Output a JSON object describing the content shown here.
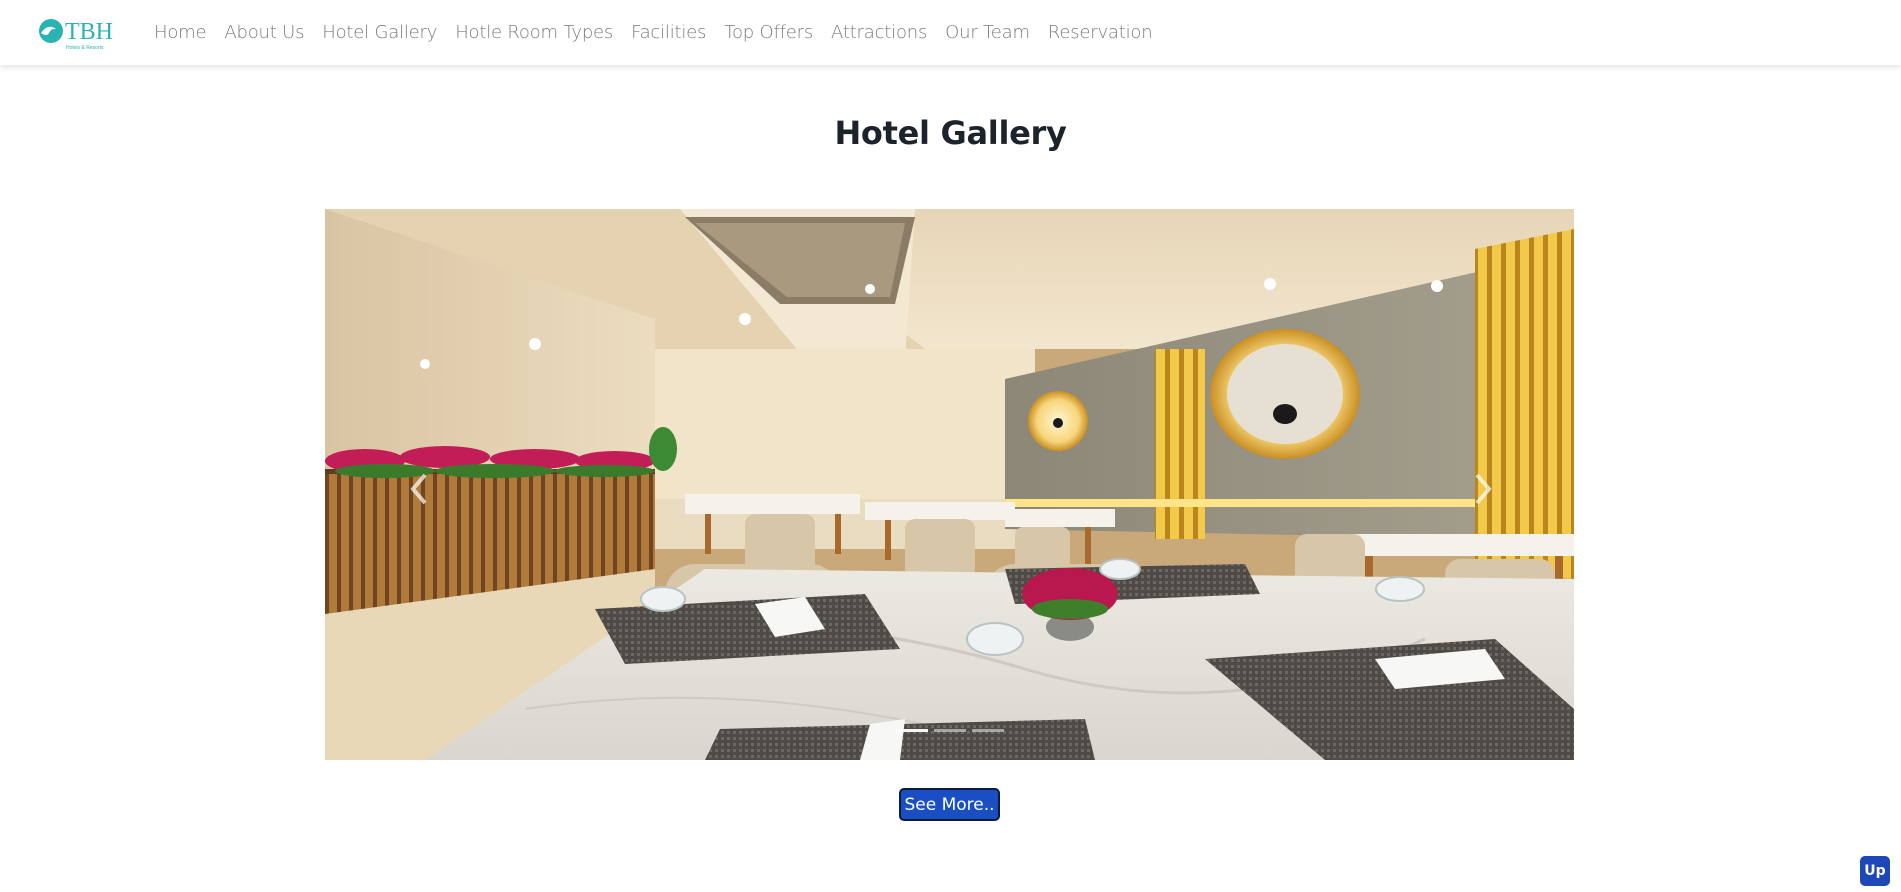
{
  "brand": {
    "logo_text": "TBH",
    "logo_subtext": "Hotels & Resorts",
    "accent_color": "#2bb3b3"
  },
  "nav": {
    "items": [
      {
        "label": "Home"
      },
      {
        "label": "About Us"
      },
      {
        "label": "Hotel Gallery"
      },
      {
        "label": "Hotle Room Types"
      },
      {
        "label": "Facilities"
      },
      {
        "label": "Top Offers"
      },
      {
        "label": "Attractions"
      },
      {
        "label": "Our Team"
      },
      {
        "label": "Reservation"
      }
    ]
  },
  "gallery": {
    "title": "Hotel Gallery",
    "image_subject": "hotel restaurant dining room",
    "prev_icon": "chevron-left-icon",
    "next_icon": "chevron-right-icon",
    "slide_count": 3,
    "active_slide": 1
  },
  "see_more_label": "See More..",
  "up_label": "Up",
  "colors": {
    "button_blue": "#1a4fc4",
    "up_blue": "#1e47b8",
    "nav_text": "#7b7b7b"
  }
}
